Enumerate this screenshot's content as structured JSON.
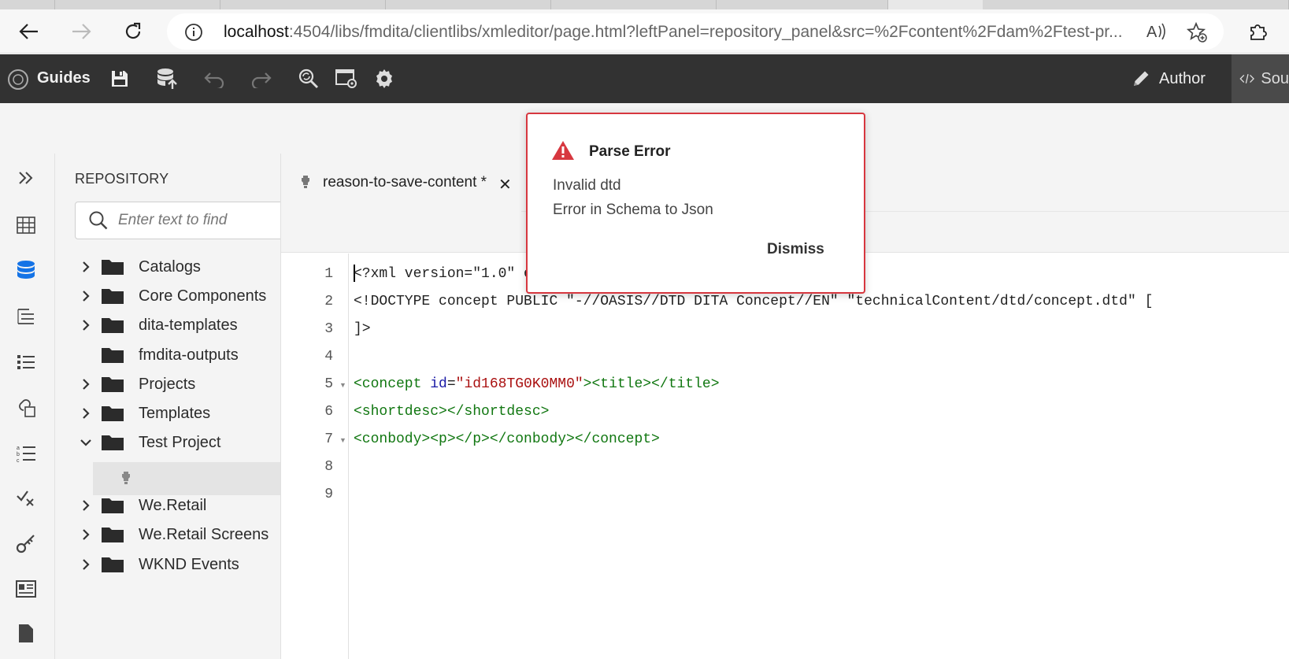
{
  "browser": {
    "url_host": "localhost",
    "url_rest": ":4504/libs/fmdita/clientlibs/xmleditor/page.html?leftPanel=repository_panel&src=%2Fcontent%2Fdam%2Ftest-pr..."
  },
  "app": {
    "brand": "Guides",
    "author_label": "Author",
    "source_label": "Sou"
  },
  "repository": {
    "title": "REPOSITORY",
    "search_placeholder": "Enter text to find",
    "items": [
      {
        "label": "Catalogs",
        "expanded": false,
        "has_children": true
      },
      {
        "label": "Core Components",
        "expanded": false,
        "has_children": true
      },
      {
        "label": "dita-templates",
        "expanded": false,
        "has_children": true
      },
      {
        "label": "fmdita-outputs",
        "expanded": false,
        "has_children": false
      },
      {
        "label": "Projects",
        "expanded": false,
        "has_children": true
      },
      {
        "label": "Templates",
        "expanded": false,
        "has_children": true
      },
      {
        "label": "Test Project",
        "expanded": true,
        "has_children": true
      },
      {
        "label": "We.Retail",
        "expanded": false,
        "has_children": true
      },
      {
        "label": "We.Retail Screens",
        "expanded": false,
        "has_children": true
      },
      {
        "label": "WKND Events",
        "expanded": false,
        "has_children": true
      }
    ]
  },
  "editor": {
    "tab_name": "reason-to-save-content *",
    "line_numbers": [
      "1",
      "2",
      "3",
      "4",
      "5",
      "6",
      "7",
      "8",
      "9"
    ],
    "lines": {
      "l1": "<?xml version=\"1.0\" e",
      "l2": "<!DOCTYPE concept PUBLIC \"-//OASIS//DTD DITA Concept//EN\" \"technicalContent/dtd/concept.dtd\" [",
      "l3": "]>",
      "l5_open": "<concept ",
      "l5_attr": "id",
      "l5_eq": "=",
      "l5_val": "\"id168TG0K0MM0\"",
      "l5_rest": "><title></title>",
      "l6": "<shortdesc></shortdesc>",
      "l7": "<conbody><p></p></conbody></concept>"
    }
  },
  "dialog": {
    "title": "Parse Error",
    "message_1": "Invalid dtd",
    "message_2": "Error in Schema to Json",
    "dismiss_label": "Dismiss"
  },
  "colors": {
    "app_bar": "#323232",
    "error_red": "#d7373f",
    "active_rail_icon": "#1473e6",
    "xml_tag": "#117711",
    "xml_attr": "#1a1aa6",
    "xml_string": "#aa1111"
  }
}
